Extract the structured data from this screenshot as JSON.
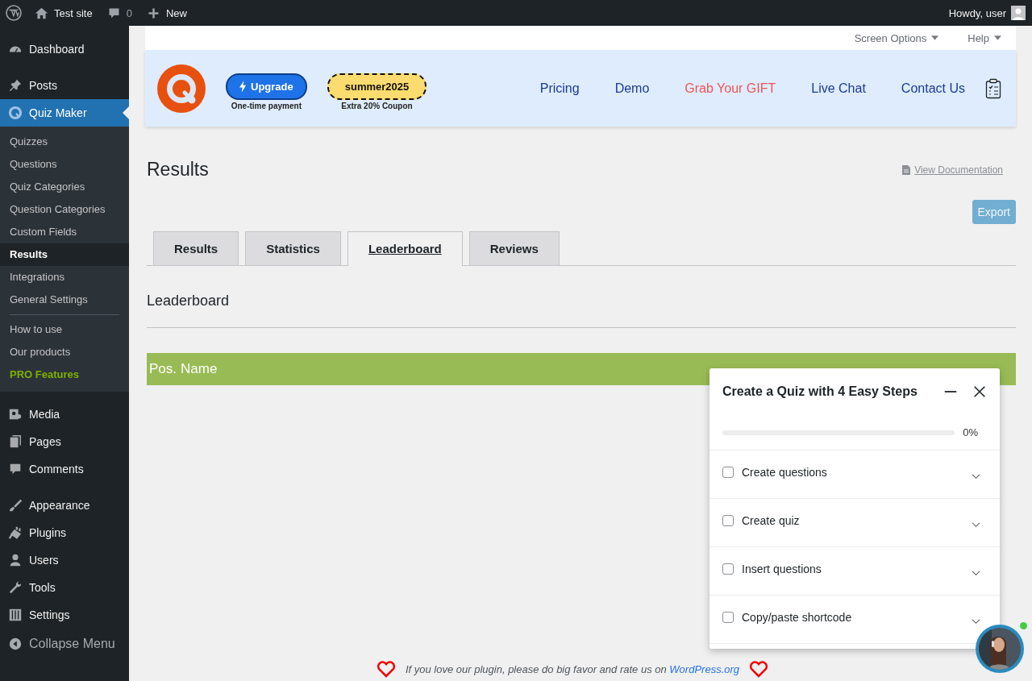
{
  "admin_bar": {
    "site": "Test site",
    "comments": "0",
    "new": "New",
    "greeting": "Howdy, user"
  },
  "sidebar": {
    "groups": [
      [
        {
          "label": "Dashboard",
          "selected": false
        }
      ],
      [
        {
          "label": "Posts",
          "selected": false
        },
        {
          "label": "Quiz Maker",
          "selected": true,
          "submenu": [
            [
              {
                "label": "Quizzes",
                "selected": false,
                "kind": "link"
              },
              {
                "label": "Questions",
                "selected": false,
                "kind": "link"
              },
              {
                "label": "Quiz Categories",
                "selected": false,
                "kind": "link"
              },
              {
                "label": "Question Categories",
                "selected": false,
                "kind": "link"
              },
              {
                "label": "Custom Fields",
                "selected": false,
                "kind": "link"
              },
              {
                "label": "Results",
                "selected": true,
                "kind": "link"
              },
              {
                "label": "Integrations",
                "selected": false,
                "kind": "link"
              },
              {
                "label": "General Settings",
                "selected": false,
                "kind": "link"
              }
            ],
            [
              {
                "label": "How to use",
                "selected": false,
                "kind": "link"
              },
              {
                "label": "Our products",
                "selected": false,
                "kind": "link"
              },
              {
                "label": "PRO Features",
                "selected": false,
                "kind": "pro"
              }
            ]
          ]
        }
      ],
      [
        {
          "label": "Media",
          "selected": false
        },
        {
          "label": "Pages",
          "selected": false
        },
        {
          "label": "Comments",
          "selected": false
        }
      ],
      [
        {
          "label": "Appearance",
          "selected": false
        },
        {
          "label": "Plugins",
          "selected": false
        },
        {
          "label": "Users",
          "selected": false
        },
        {
          "label": "Tools",
          "selected": false
        },
        {
          "label": "Settings",
          "selected": false
        }
      ]
    ],
    "collapse": "Collapse Menu"
  },
  "screen_meta": [
    "Screen Options",
    "Help"
  ],
  "banner": {
    "upgrade": "Upgrade",
    "upgrade_note": "One-time payment",
    "coupon": "summer2025",
    "coupon_note": "Extra 20% Coupon",
    "links": [
      {
        "label": "Pricing",
        "kind": "normal"
      },
      {
        "label": "Demo",
        "kind": "normal"
      },
      {
        "label": "Grab Your GIFT",
        "kind": "highlight"
      },
      {
        "label": "Live Chat",
        "kind": "normal"
      },
      {
        "label": "Contact Us",
        "kind": "normal"
      }
    ]
  },
  "page": {
    "title": "Results",
    "doc_link": "View Documentation",
    "export": "Export"
  },
  "tabs": [
    {
      "label": "Results",
      "selected": false
    },
    {
      "label": "Statistics",
      "selected": false
    },
    {
      "label": "Leaderboard",
      "selected": true
    },
    {
      "label": "Reviews",
      "selected": false
    }
  ],
  "section_title": "Leaderboard",
  "table": {
    "columns": [
      "Pos.",
      "Name"
    ]
  },
  "steps_panel": {
    "title": "Create a Quiz with 4 Easy Steps",
    "level": 0,
    "reading": "0%",
    "steps": [
      {
        "label": "Create questions",
        "checked": false
      },
      {
        "label": "Create quiz",
        "checked": false
      },
      {
        "label": "Insert questions",
        "checked": false
      },
      {
        "label": "Copy/paste shortcode",
        "checked": false
      }
    ]
  },
  "footer": {
    "text": "If you love our plugin, please do big favor and rate us on",
    "link": "WordPress.org"
  }
}
